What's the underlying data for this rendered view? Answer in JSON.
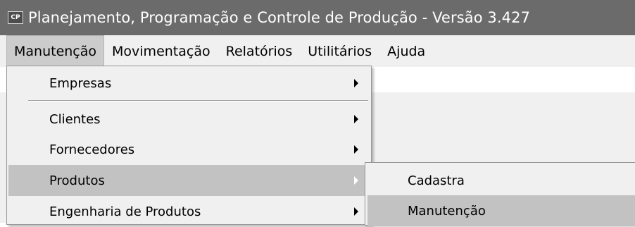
{
  "window": {
    "icon_text": "CP",
    "icon_name": "app-icon",
    "title": "Planejamento, Programação e Controle de Produção - Versão 3.427"
  },
  "menubar": {
    "items": [
      {
        "label": "Manutenção",
        "active": true
      },
      {
        "label": "Movimentação",
        "active": false
      },
      {
        "label": "Relatórios",
        "active": false
      },
      {
        "label": "Utilitários",
        "active": false
      },
      {
        "label": "Ajuda",
        "active": false
      }
    ]
  },
  "manutencao_menu": {
    "items": [
      {
        "label": "Empresas",
        "has_submenu": true,
        "highlighted": false
      },
      {
        "label": "Clientes",
        "has_submenu": true,
        "highlighted": false
      },
      {
        "label": "Fornecedores",
        "has_submenu": true,
        "highlighted": false
      },
      {
        "label": "Produtos",
        "has_submenu": true,
        "highlighted": true
      },
      {
        "label": "Engenharia de Produtos",
        "has_submenu": true,
        "highlighted": false
      }
    ]
  },
  "produtos_submenu": {
    "items": [
      {
        "label": "Cadastra",
        "highlighted": false
      },
      {
        "label": "Manutenção",
        "highlighted": true
      }
    ]
  },
  "colors": {
    "titlebar": "#6b6b6b",
    "menu_background": "#f0f0f0",
    "highlight": "#c2c2c2"
  }
}
